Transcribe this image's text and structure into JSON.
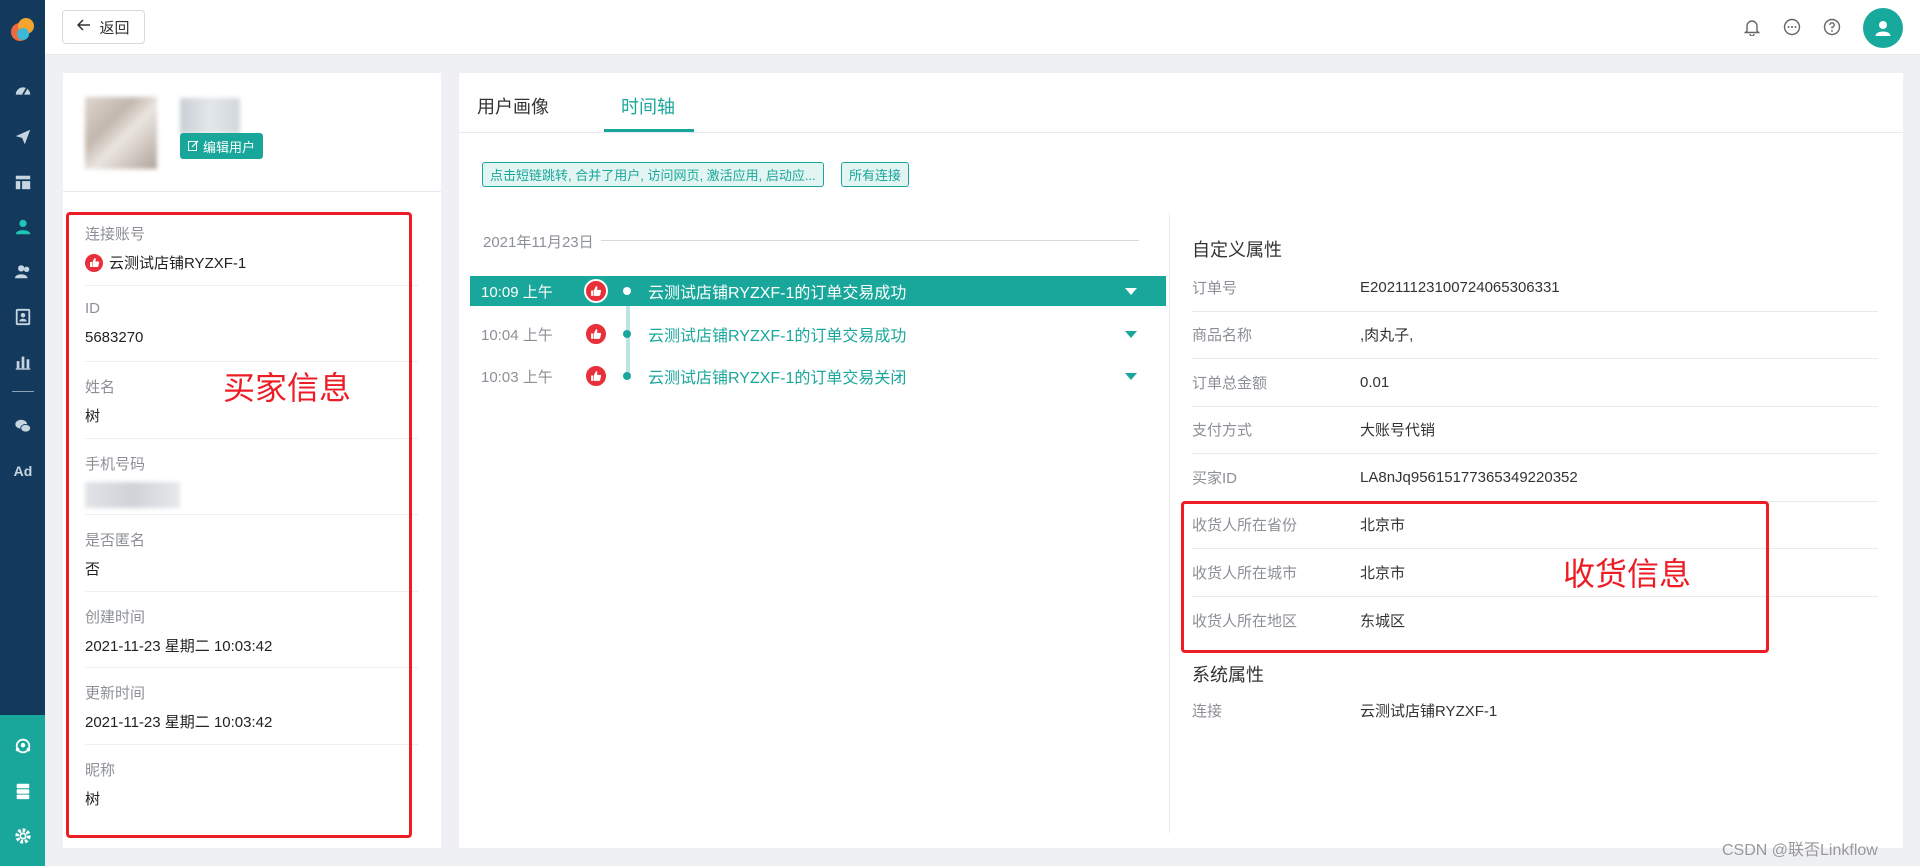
{
  "colors": {
    "accent": "#1aa79b",
    "sidebar": "#133a5c",
    "annotation": "#ee1c24",
    "like": "#e8303b"
  },
  "topbar": {
    "back_label": "返回",
    "icons": [
      "bell-icon",
      "chat-icon",
      "help-icon",
      "user-avatar-icon"
    ]
  },
  "sidebar": {
    "icons": [
      "dashboard-icon",
      "send-icon",
      "layout-icon",
      "user-icon",
      "users-icon",
      "contact-icon",
      "bar-chart-icon",
      "wechat-icon",
      "ad-icon",
      "team-icon",
      "server-icon",
      "settings-icon"
    ],
    "ad_label": "Ad"
  },
  "profile": {
    "edit_button": "编辑用户",
    "fields": [
      {
        "label": "连接账号",
        "value": "云测试店铺RYZXF-1"
      },
      {
        "label": "ID",
        "value": "5683270"
      },
      {
        "label": "姓名",
        "value": "树"
      },
      {
        "label": "手机号码",
        "value": ""
      },
      {
        "label": "是否匿名",
        "value": "否"
      },
      {
        "label": "创建时间",
        "value": "2021-11-23 星期二 10:03:42"
      },
      {
        "label": "更新时间",
        "value": "2021-11-23 星期二 10:03:42"
      },
      {
        "label": "昵称",
        "value": "树"
      }
    ]
  },
  "annotations": {
    "buyer_info": "买家信息",
    "shipping_info": "收货信息"
  },
  "tabs": [
    {
      "label": "用户画像",
      "active": false
    },
    {
      "label": "时间轴",
      "active": true
    }
  ],
  "filters": {
    "events": "点击短链跳转, 合并了用户, 访问网页, 激活应用, 启动应...",
    "connections": "所有连接"
  },
  "timeline": {
    "date": "2021年11月23日",
    "events": [
      {
        "time": "10:09 上午",
        "title": "云测试店铺RYZXF-1的订单交易成功",
        "active": true
      },
      {
        "time": "10:04 上午",
        "title": "云测试店铺RYZXF-1的订单交易成功",
        "active": false
      },
      {
        "time": "10:03 上午",
        "title": "云测试店铺RYZXF-1的订单交易关闭",
        "active": false
      }
    ]
  },
  "custom_attributes": {
    "title": "自定义属性",
    "rows": [
      {
        "label": "订单号",
        "value": "E20211123100724065306331"
      },
      {
        "label": "商品名称",
        "value": ",肉丸子,"
      },
      {
        "label": "订单总金额",
        "value": "0.01"
      },
      {
        "label": "支付方式",
        "value": "大账号代销"
      },
      {
        "label": "买家ID",
        "value": "LA8nJq95615177365349220352"
      },
      {
        "label": "收货人所在省份",
        "value": "北京市"
      },
      {
        "label": "收货人所在城市",
        "value": "北京市"
      },
      {
        "label": "收货人所在地区",
        "value": "东城区"
      }
    ]
  },
  "system_attributes": {
    "title": "系统属性",
    "rows": [
      {
        "label": "连接",
        "value": "云测试店铺RYZXF-1"
      }
    ]
  },
  "watermark": "CSDN @联否Linkflow"
}
